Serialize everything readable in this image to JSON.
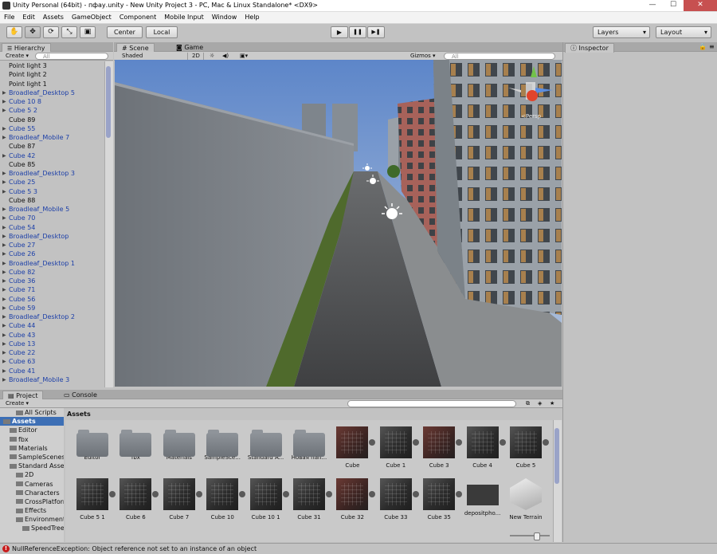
{
  "window": {
    "title": "Unity Personal (64bit) - пфау.unity - New Unity Project 3 - PC, Mac & Linux Standalone* <DX9>",
    "minimize": "—",
    "maximize": "☐",
    "close": "✕"
  },
  "menu": [
    "File",
    "Edit",
    "Assets",
    "GameObject",
    "Component",
    "Mobile Input",
    "Window",
    "Help"
  ],
  "toolbar": {
    "tools": [
      "hand-tool",
      "move-tool",
      "rotate-tool",
      "scale-tool",
      "rect-tool"
    ],
    "tool_glyphs": [
      "✋",
      "✥",
      "⟳",
      "⤡",
      "▣"
    ],
    "center_label": "Center",
    "local_label": "Local",
    "play": "▶",
    "pause": "❚❚",
    "step": "▶❚",
    "layers_label": "Layers",
    "layout_label": "Layout"
  },
  "hierarchy": {
    "tab_label": "Hierarchy",
    "create_label": "Create",
    "search_placeholder": "All",
    "items": [
      {
        "label": "Point light 3",
        "prefab": false,
        "expandable": false
      },
      {
        "label": "Point light 2",
        "prefab": false,
        "expandable": false
      },
      {
        "label": "Point light 1",
        "prefab": false,
        "expandable": false
      },
      {
        "label": "Broadleaf_Desktop 5",
        "prefab": true,
        "expandable": true
      },
      {
        "label": "Cube 10 8",
        "prefab": true,
        "expandable": true
      },
      {
        "label": "Cube 5 2",
        "prefab": true,
        "expandable": true
      },
      {
        "label": "Cube 89",
        "prefab": false,
        "expandable": false
      },
      {
        "label": "Cube 55",
        "prefab": true,
        "expandable": true
      },
      {
        "label": "Broadleaf_Mobile 7",
        "prefab": true,
        "expandable": true
      },
      {
        "label": "Cube 87",
        "prefab": false,
        "expandable": false
      },
      {
        "label": "Cube 42",
        "prefab": true,
        "expandable": true
      },
      {
        "label": "Cube 85",
        "prefab": false,
        "expandable": false
      },
      {
        "label": "Broadleaf_Desktop 3",
        "prefab": true,
        "expandable": true
      },
      {
        "label": "Cube 25",
        "prefab": true,
        "expandable": true
      },
      {
        "label": "Cube 5 3",
        "prefab": true,
        "expandable": true
      },
      {
        "label": "Cube 88",
        "prefab": false,
        "expandable": false
      },
      {
        "label": "Broadleaf_Mobile 5",
        "prefab": true,
        "expandable": true
      },
      {
        "label": "Cube 70",
        "prefab": true,
        "expandable": true
      },
      {
        "label": "Cube 54",
        "prefab": true,
        "expandable": true
      },
      {
        "label": "Broadleaf_Desktop",
        "prefab": true,
        "expandable": true
      },
      {
        "label": "Cube 27",
        "prefab": true,
        "expandable": true
      },
      {
        "label": "Cube 26",
        "prefab": true,
        "expandable": true
      },
      {
        "label": "Broadleaf_Desktop 1",
        "prefab": true,
        "expandable": true
      },
      {
        "label": "Cube 82",
        "prefab": true,
        "expandable": true
      },
      {
        "label": "Cube 36",
        "prefab": true,
        "expandable": true
      },
      {
        "label": "Cube 71",
        "prefab": true,
        "expandable": true
      },
      {
        "label": "Cube 56",
        "prefab": true,
        "expandable": true
      },
      {
        "label": "Cube 59",
        "prefab": true,
        "expandable": true
      },
      {
        "label": "Broadleaf_Desktop 2",
        "prefab": true,
        "expandable": true
      },
      {
        "label": "Cube 44",
        "prefab": true,
        "expandable": true
      },
      {
        "label": "Cube 43",
        "prefab": true,
        "expandable": true
      },
      {
        "label": "Cube 13",
        "prefab": true,
        "expandable": true
      },
      {
        "label": "Cube 22",
        "prefab": true,
        "expandable": true
      },
      {
        "label": "Cube 63",
        "prefab": true,
        "expandable": true
      },
      {
        "label": "Cube 41",
        "prefab": true,
        "expandable": true
      },
      {
        "label": "Broadleaf_Mobile 3",
        "prefab": true,
        "expandable": true
      }
    ]
  },
  "scene": {
    "tab_label": "Scene",
    "game_tab_label": "Game",
    "shading_mode": "Shaded",
    "mode_2d": "2D",
    "gizmos_label": "Gizmos",
    "search_placeholder": "All",
    "persp_label": "<Persp"
  },
  "inspector": {
    "tab_label": "Inspector"
  },
  "project": {
    "tab_label": "Project",
    "console_tab_label": "Console",
    "create_label": "Create",
    "breadcrumb": "Assets",
    "tree": [
      {
        "label": "All Scripts",
        "indent": 2,
        "selected": false
      },
      {
        "label": "Assets",
        "indent": 0,
        "selected": true
      },
      {
        "label": "Editor",
        "indent": 1,
        "selected": false
      },
      {
        "label": "fbx",
        "indent": 1,
        "selected": false
      },
      {
        "label": "Materials",
        "indent": 1,
        "selected": false
      },
      {
        "label": "SampleScenes",
        "indent": 1,
        "selected": false
      },
      {
        "label": "Standard Assets",
        "indent": 1,
        "selected": false
      },
      {
        "label": "2D",
        "indent": 2,
        "selected": false
      },
      {
        "label": "Cameras",
        "indent": 2,
        "selected": false
      },
      {
        "label": "Characters",
        "indent": 2,
        "selected": false
      },
      {
        "label": "CrossPlatformInput",
        "indent": 2,
        "selected": false
      },
      {
        "label": "Effects",
        "indent": 2,
        "selected": false
      },
      {
        "label": "Environment",
        "indent": 2,
        "selected": false
      },
      {
        "label": "SpeedTree",
        "indent": 3,
        "selected": false
      }
    ],
    "assets": [
      {
        "label": "Editor",
        "kind": "folder"
      },
      {
        "label": "fbx",
        "kind": "folder"
      },
      {
        "label": "Materials",
        "kind": "folder"
      },
      {
        "label": "SampleSce...",
        "kind": "folder"
      },
      {
        "label": "Standard A...",
        "kind": "folder"
      },
      {
        "label": "Новая пап...",
        "kind": "folder"
      },
      {
        "label": "Cube",
        "kind": "cube-red"
      },
      {
        "label": "Cube 1",
        "kind": "cube"
      },
      {
        "label": "Cube 3",
        "kind": "cube-red"
      },
      {
        "label": "Cube 4",
        "kind": "cube"
      },
      {
        "label": "Cube 5",
        "kind": "cube"
      },
      {
        "label": "Cube 5 1",
        "kind": "cube"
      },
      {
        "label": "Cube 6",
        "kind": "cube"
      },
      {
        "label": "Cube 7",
        "kind": "cube"
      },
      {
        "label": "Cube 10",
        "kind": "cube"
      },
      {
        "label": "Cube 10 1",
        "kind": "cube"
      },
      {
        "label": "Cube 31",
        "kind": "cube"
      },
      {
        "label": "Cube 32",
        "kind": "cube-red"
      },
      {
        "label": "Cube 33",
        "kind": "cube"
      },
      {
        "label": "Cube 35",
        "kind": "cube"
      },
      {
        "label": "depositpho...",
        "kind": "texture"
      },
      {
        "label": "New Terrain",
        "kind": "terrain"
      }
    ]
  },
  "status": {
    "icon": "!",
    "message": "NullReferenceException: Object reference not set to an instance of an object"
  }
}
